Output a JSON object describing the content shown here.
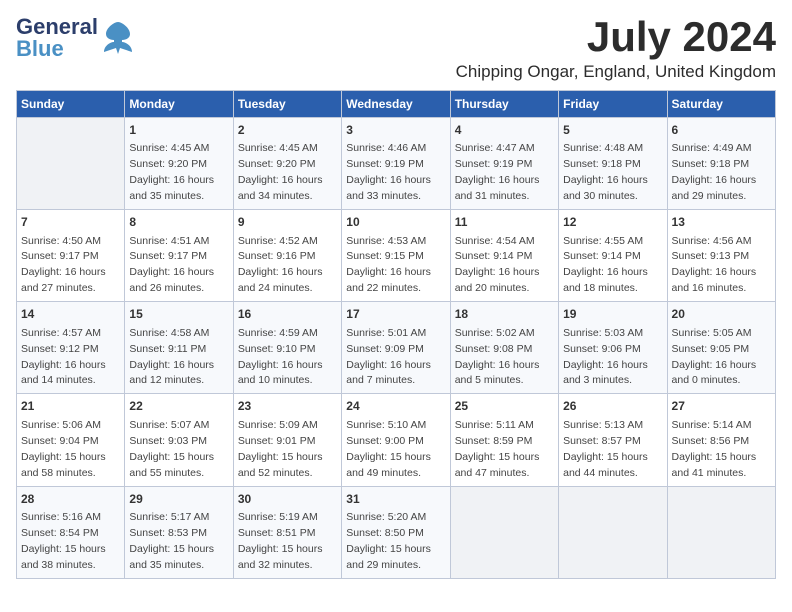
{
  "logo": {
    "name_part1": "General",
    "name_part2": "Blue",
    "tagline": "Blue"
  },
  "title": {
    "month_year": "July 2024",
    "location": "Chipping Ongar, England, United Kingdom"
  },
  "weekdays": [
    "Sunday",
    "Monday",
    "Tuesday",
    "Wednesday",
    "Thursday",
    "Friday",
    "Saturday"
  ],
  "weeks": [
    [
      {
        "day": "",
        "info": ""
      },
      {
        "day": "1",
        "info": "Sunrise: 4:45 AM\nSunset: 9:20 PM\nDaylight: 16 hours\nand 35 minutes."
      },
      {
        "day": "2",
        "info": "Sunrise: 4:45 AM\nSunset: 9:20 PM\nDaylight: 16 hours\nand 34 minutes."
      },
      {
        "day": "3",
        "info": "Sunrise: 4:46 AM\nSunset: 9:19 PM\nDaylight: 16 hours\nand 33 minutes."
      },
      {
        "day": "4",
        "info": "Sunrise: 4:47 AM\nSunset: 9:19 PM\nDaylight: 16 hours\nand 31 minutes."
      },
      {
        "day": "5",
        "info": "Sunrise: 4:48 AM\nSunset: 9:18 PM\nDaylight: 16 hours\nand 30 minutes."
      },
      {
        "day": "6",
        "info": "Sunrise: 4:49 AM\nSunset: 9:18 PM\nDaylight: 16 hours\nand 29 minutes."
      }
    ],
    [
      {
        "day": "7",
        "info": "Sunrise: 4:50 AM\nSunset: 9:17 PM\nDaylight: 16 hours\nand 27 minutes."
      },
      {
        "day": "8",
        "info": "Sunrise: 4:51 AM\nSunset: 9:17 PM\nDaylight: 16 hours\nand 26 minutes."
      },
      {
        "day": "9",
        "info": "Sunrise: 4:52 AM\nSunset: 9:16 PM\nDaylight: 16 hours\nand 24 minutes."
      },
      {
        "day": "10",
        "info": "Sunrise: 4:53 AM\nSunset: 9:15 PM\nDaylight: 16 hours\nand 22 minutes."
      },
      {
        "day": "11",
        "info": "Sunrise: 4:54 AM\nSunset: 9:14 PM\nDaylight: 16 hours\nand 20 minutes."
      },
      {
        "day": "12",
        "info": "Sunrise: 4:55 AM\nSunset: 9:14 PM\nDaylight: 16 hours\nand 18 minutes."
      },
      {
        "day": "13",
        "info": "Sunrise: 4:56 AM\nSunset: 9:13 PM\nDaylight: 16 hours\nand 16 minutes."
      }
    ],
    [
      {
        "day": "14",
        "info": "Sunrise: 4:57 AM\nSunset: 9:12 PM\nDaylight: 16 hours\nand 14 minutes."
      },
      {
        "day": "15",
        "info": "Sunrise: 4:58 AM\nSunset: 9:11 PM\nDaylight: 16 hours\nand 12 minutes."
      },
      {
        "day": "16",
        "info": "Sunrise: 4:59 AM\nSunset: 9:10 PM\nDaylight: 16 hours\nand 10 minutes."
      },
      {
        "day": "17",
        "info": "Sunrise: 5:01 AM\nSunset: 9:09 PM\nDaylight: 16 hours\nand 7 minutes."
      },
      {
        "day": "18",
        "info": "Sunrise: 5:02 AM\nSunset: 9:08 PM\nDaylight: 16 hours\nand 5 minutes."
      },
      {
        "day": "19",
        "info": "Sunrise: 5:03 AM\nSunset: 9:06 PM\nDaylight: 16 hours\nand 3 minutes."
      },
      {
        "day": "20",
        "info": "Sunrise: 5:05 AM\nSunset: 9:05 PM\nDaylight: 16 hours\nand 0 minutes."
      }
    ],
    [
      {
        "day": "21",
        "info": "Sunrise: 5:06 AM\nSunset: 9:04 PM\nDaylight: 15 hours\nand 58 minutes."
      },
      {
        "day": "22",
        "info": "Sunrise: 5:07 AM\nSunset: 9:03 PM\nDaylight: 15 hours\nand 55 minutes."
      },
      {
        "day": "23",
        "info": "Sunrise: 5:09 AM\nSunset: 9:01 PM\nDaylight: 15 hours\nand 52 minutes."
      },
      {
        "day": "24",
        "info": "Sunrise: 5:10 AM\nSunset: 9:00 PM\nDaylight: 15 hours\nand 49 minutes."
      },
      {
        "day": "25",
        "info": "Sunrise: 5:11 AM\nSunset: 8:59 PM\nDaylight: 15 hours\nand 47 minutes."
      },
      {
        "day": "26",
        "info": "Sunrise: 5:13 AM\nSunset: 8:57 PM\nDaylight: 15 hours\nand 44 minutes."
      },
      {
        "day": "27",
        "info": "Sunrise: 5:14 AM\nSunset: 8:56 PM\nDaylight: 15 hours\nand 41 minutes."
      }
    ],
    [
      {
        "day": "28",
        "info": "Sunrise: 5:16 AM\nSunset: 8:54 PM\nDaylight: 15 hours\nand 38 minutes."
      },
      {
        "day": "29",
        "info": "Sunrise: 5:17 AM\nSunset: 8:53 PM\nDaylight: 15 hours\nand 35 minutes."
      },
      {
        "day": "30",
        "info": "Sunrise: 5:19 AM\nSunset: 8:51 PM\nDaylight: 15 hours\nand 32 minutes."
      },
      {
        "day": "31",
        "info": "Sunrise: 5:20 AM\nSunset: 8:50 PM\nDaylight: 15 hours\nand 29 minutes."
      },
      {
        "day": "",
        "info": ""
      },
      {
        "day": "",
        "info": ""
      },
      {
        "day": "",
        "info": ""
      }
    ]
  ]
}
